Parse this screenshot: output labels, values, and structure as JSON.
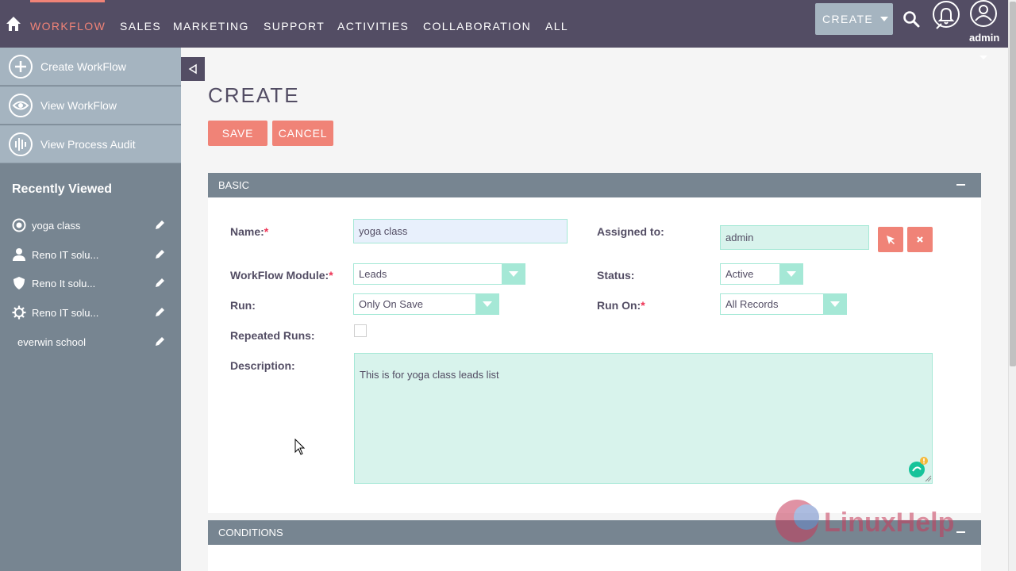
{
  "nav": {
    "items": [
      "WORKFLOW",
      "SALES",
      "MARKETING",
      "SUPPORT",
      "ACTIVITIES",
      "COLLABORATION",
      "ALL"
    ],
    "create_label": "CREATE",
    "user_label": "admin",
    "accent": "#f08377"
  },
  "sidebar": {
    "actions": [
      {
        "label": "Create WorkFlow",
        "icon": "plus-circle-icon"
      },
      {
        "label": "View WorkFlow",
        "icon": "eye-icon"
      },
      {
        "label": "View Process Audit",
        "icon": "audit-bars-icon"
      }
    ],
    "recent_title": "Recently Viewed",
    "recent": [
      {
        "label": "yoga class",
        "icon": "target-icon"
      },
      {
        "label": "Reno IT solu...",
        "icon": "person-icon"
      },
      {
        "label": "Reno It solu...",
        "icon": "shield-icon"
      },
      {
        "label": "Reno IT solu...",
        "icon": "gear-icon"
      },
      {
        "label": "everwin school",
        "icon": ""
      }
    ]
  },
  "page": {
    "title": "CREATE",
    "save_label": "SAVE",
    "cancel_label": "CANCEL"
  },
  "basic": {
    "header": "BASIC",
    "name_label": "Name:",
    "name_value": "yoga class",
    "assigned_label": "Assigned to:",
    "assigned_value": "admin",
    "module_label": "WorkFlow Module:",
    "module_value": "Leads",
    "status_label": "Status:",
    "status_value": "Active",
    "run_label": "Run:",
    "run_value": "Only On Save",
    "runon_label": "Run On:",
    "runon_value": "All Records",
    "repeated_label": "Repeated Runs:",
    "repeated_checked": false,
    "description_label": "Description:",
    "description_value": "This is for yoga class leads list",
    "required_mark": "*"
  },
  "conditions": {
    "header": "CONDITIONS"
  },
  "watermark": {
    "text": "LinuxHelp"
  }
}
